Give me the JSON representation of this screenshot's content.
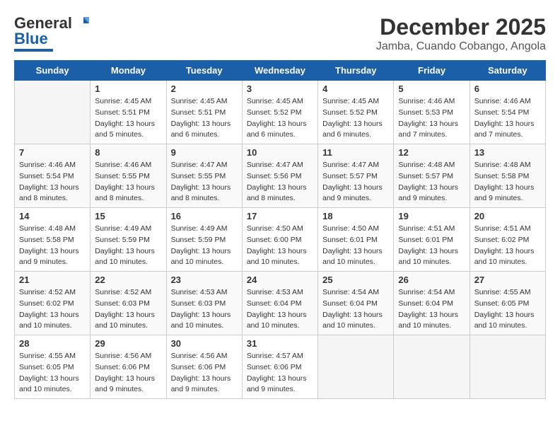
{
  "header": {
    "logo_general": "General",
    "logo_blue": "Blue",
    "title": "December 2025",
    "subtitle": "Jamba, Cuando Cobango, Angola"
  },
  "weekdays": [
    "Sunday",
    "Monday",
    "Tuesday",
    "Wednesday",
    "Thursday",
    "Friday",
    "Saturday"
  ],
  "weeks": [
    [
      {
        "day": "",
        "info": ""
      },
      {
        "day": "1",
        "info": "Sunrise: 4:45 AM\nSunset: 5:51 PM\nDaylight: 13 hours\nand 5 minutes."
      },
      {
        "day": "2",
        "info": "Sunrise: 4:45 AM\nSunset: 5:51 PM\nDaylight: 13 hours\nand 6 minutes."
      },
      {
        "day": "3",
        "info": "Sunrise: 4:45 AM\nSunset: 5:52 PM\nDaylight: 13 hours\nand 6 minutes."
      },
      {
        "day": "4",
        "info": "Sunrise: 4:45 AM\nSunset: 5:52 PM\nDaylight: 13 hours\nand 6 minutes."
      },
      {
        "day": "5",
        "info": "Sunrise: 4:46 AM\nSunset: 5:53 PM\nDaylight: 13 hours\nand 7 minutes."
      },
      {
        "day": "6",
        "info": "Sunrise: 4:46 AM\nSunset: 5:54 PM\nDaylight: 13 hours\nand 7 minutes."
      }
    ],
    [
      {
        "day": "7",
        "info": "Sunrise: 4:46 AM\nSunset: 5:54 PM\nDaylight: 13 hours\nand 8 minutes."
      },
      {
        "day": "8",
        "info": "Sunrise: 4:46 AM\nSunset: 5:55 PM\nDaylight: 13 hours\nand 8 minutes."
      },
      {
        "day": "9",
        "info": "Sunrise: 4:47 AM\nSunset: 5:55 PM\nDaylight: 13 hours\nand 8 minutes."
      },
      {
        "day": "10",
        "info": "Sunrise: 4:47 AM\nSunset: 5:56 PM\nDaylight: 13 hours\nand 8 minutes."
      },
      {
        "day": "11",
        "info": "Sunrise: 4:47 AM\nSunset: 5:57 PM\nDaylight: 13 hours\nand 9 minutes."
      },
      {
        "day": "12",
        "info": "Sunrise: 4:48 AM\nSunset: 5:57 PM\nDaylight: 13 hours\nand 9 minutes."
      },
      {
        "day": "13",
        "info": "Sunrise: 4:48 AM\nSunset: 5:58 PM\nDaylight: 13 hours\nand 9 minutes."
      }
    ],
    [
      {
        "day": "14",
        "info": "Sunrise: 4:48 AM\nSunset: 5:58 PM\nDaylight: 13 hours\nand 9 minutes."
      },
      {
        "day": "15",
        "info": "Sunrise: 4:49 AM\nSunset: 5:59 PM\nDaylight: 13 hours\nand 10 minutes."
      },
      {
        "day": "16",
        "info": "Sunrise: 4:49 AM\nSunset: 5:59 PM\nDaylight: 13 hours\nand 10 minutes."
      },
      {
        "day": "17",
        "info": "Sunrise: 4:50 AM\nSunset: 6:00 PM\nDaylight: 13 hours\nand 10 minutes."
      },
      {
        "day": "18",
        "info": "Sunrise: 4:50 AM\nSunset: 6:01 PM\nDaylight: 13 hours\nand 10 minutes."
      },
      {
        "day": "19",
        "info": "Sunrise: 4:51 AM\nSunset: 6:01 PM\nDaylight: 13 hours\nand 10 minutes."
      },
      {
        "day": "20",
        "info": "Sunrise: 4:51 AM\nSunset: 6:02 PM\nDaylight: 13 hours\nand 10 minutes."
      }
    ],
    [
      {
        "day": "21",
        "info": "Sunrise: 4:52 AM\nSunset: 6:02 PM\nDaylight: 13 hours\nand 10 minutes."
      },
      {
        "day": "22",
        "info": "Sunrise: 4:52 AM\nSunset: 6:03 PM\nDaylight: 13 hours\nand 10 minutes."
      },
      {
        "day": "23",
        "info": "Sunrise: 4:53 AM\nSunset: 6:03 PM\nDaylight: 13 hours\nand 10 minutes."
      },
      {
        "day": "24",
        "info": "Sunrise: 4:53 AM\nSunset: 6:04 PM\nDaylight: 13 hours\nand 10 minutes."
      },
      {
        "day": "25",
        "info": "Sunrise: 4:54 AM\nSunset: 6:04 PM\nDaylight: 13 hours\nand 10 minutes."
      },
      {
        "day": "26",
        "info": "Sunrise: 4:54 AM\nSunset: 6:04 PM\nDaylight: 13 hours\nand 10 minutes."
      },
      {
        "day": "27",
        "info": "Sunrise: 4:55 AM\nSunset: 6:05 PM\nDaylight: 13 hours\nand 10 minutes."
      }
    ],
    [
      {
        "day": "28",
        "info": "Sunrise: 4:55 AM\nSunset: 6:05 PM\nDaylight: 13 hours\nand 10 minutes."
      },
      {
        "day": "29",
        "info": "Sunrise: 4:56 AM\nSunset: 6:06 PM\nDaylight: 13 hours\nand 9 minutes."
      },
      {
        "day": "30",
        "info": "Sunrise: 4:56 AM\nSunset: 6:06 PM\nDaylight: 13 hours\nand 9 minutes."
      },
      {
        "day": "31",
        "info": "Sunrise: 4:57 AM\nSunset: 6:06 PM\nDaylight: 13 hours\nand 9 minutes."
      },
      {
        "day": "",
        "info": ""
      },
      {
        "day": "",
        "info": ""
      },
      {
        "day": "",
        "info": ""
      }
    ]
  ]
}
